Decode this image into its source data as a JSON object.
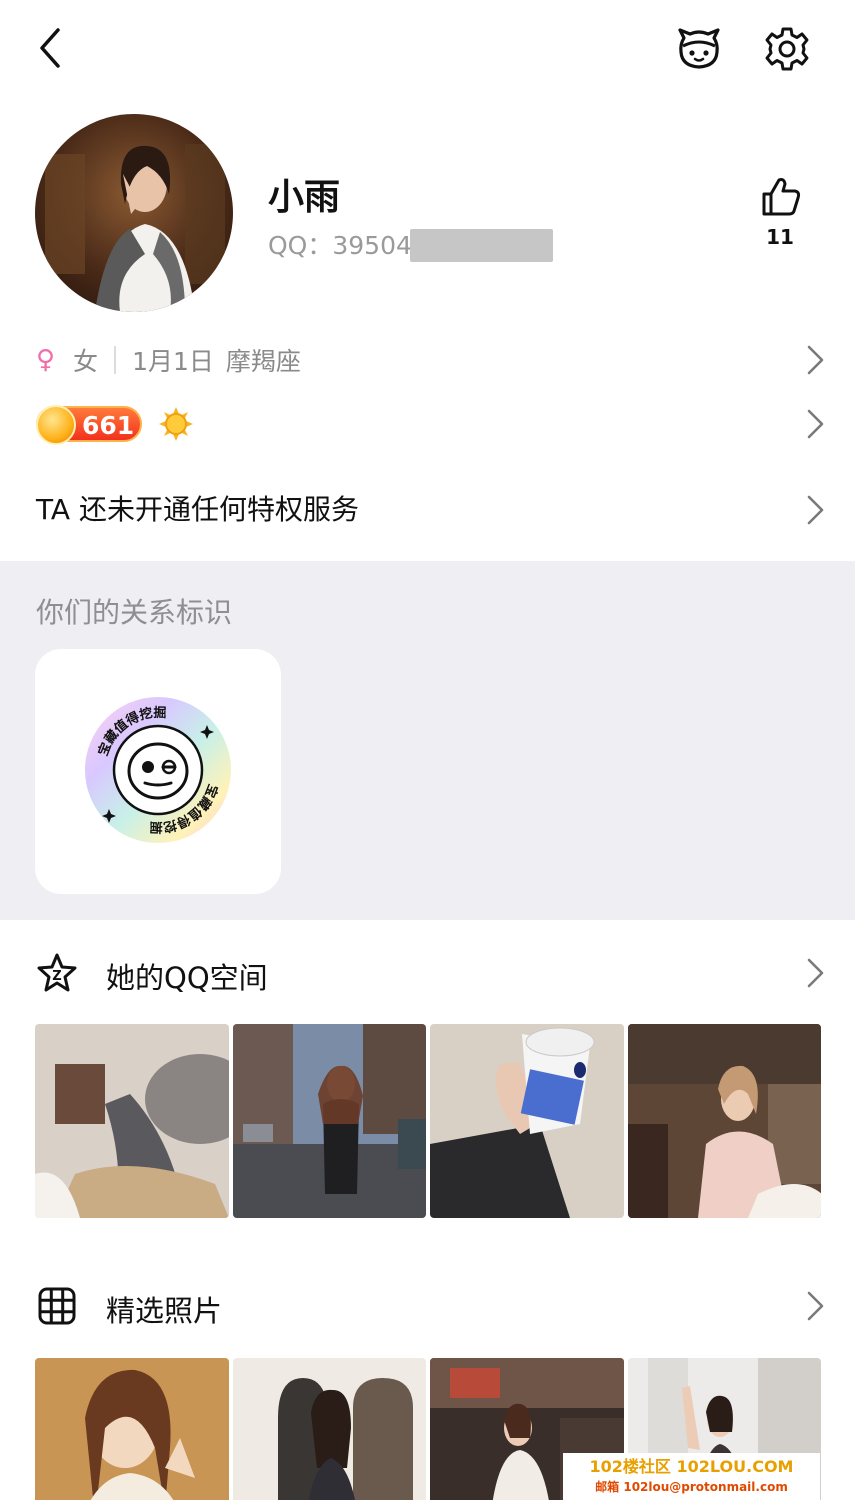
{
  "profile": {
    "name": "小雨",
    "qq_label": "QQ：",
    "qq_prefix": "39504",
    "like_count": "11",
    "gender": "女",
    "birthday": "1月1日",
    "zodiac": "摩羯座",
    "level": "661",
    "privilege_text": "TA 还未开通任何特权服务"
  },
  "relationship": {
    "title": "你们的关系标识",
    "badge_text": "宝藏值得挖掘"
  },
  "sections": {
    "qzone_label": "她的QQ空间",
    "photos_label": "精选照片"
  },
  "icons": [
    "back-arrow-icon",
    "pet-icon",
    "gear-icon",
    "thumbs-up-icon",
    "female-icon",
    "chevron-right-icon",
    "sun-icon",
    "qzone-star-icon",
    "grid-icon"
  ],
  "watermark": {
    "line1": "102楼社区 102LOU.COM",
    "line2": "邮箱 102lou@protonmail.com"
  },
  "colors": {
    "accent_female": "#f06fa9",
    "level_badge": "#f2311e",
    "section_bg": "#efeff3"
  }
}
